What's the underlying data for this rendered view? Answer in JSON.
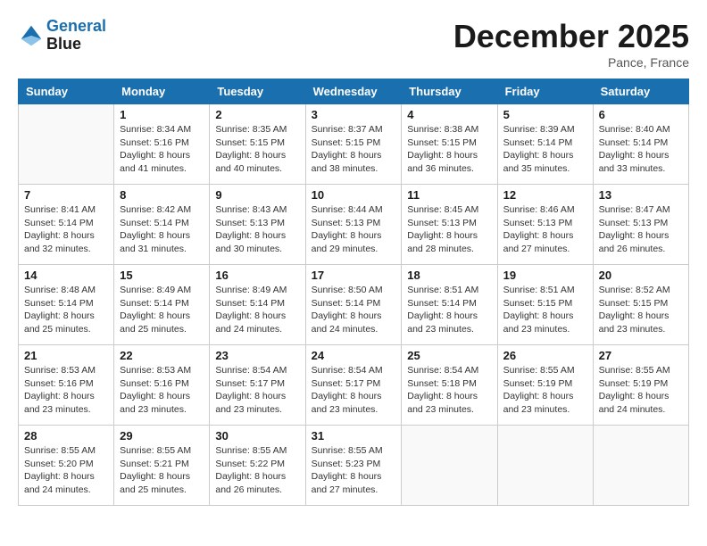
{
  "logo": {
    "text1": "General",
    "text2": "Blue"
  },
  "title": "December 2025",
  "subtitle": "Pance, France",
  "days_header": [
    "Sunday",
    "Monday",
    "Tuesday",
    "Wednesday",
    "Thursday",
    "Friday",
    "Saturday"
  ],
  "weeks": [
    [
      {
        "num": "",
        "info": ""
      },
      {
        "num": "1",
        "info": "Sunrise: 8:34 AM\nSunset: 5:16 PM\nDaylight: 8 hours\nand 41 minutes."
      },
      {
        "num": "2",
        "info": "Sunrise: 8:35 AM\nSunset: 5:15 PM\nDaylight: 8 hours\nand 40 minutes."
      },
      {
        "num": "3",
        "info": "Sunrise: 8:37 AM\nSunset: 5:15 PM\nDaylight: 8 hours\nand 38 minutes."
      },
      {
        "num": "4",
        "info": "Sunrise: 8:38 AM\nSunset: 5:15 PM\nDaylight: 8 hours\nand 36 minutes."
      },
      {
        "num": "5",
        "info": "Sunrise: 8:39 AM\nSunset: 5:14 PM\nDaylight: 8 hours\nand 35 minutes."
      },
      {
        "num": "6",
        "info": "Sunrise: 8:40 AM\nSunset: 5:14 PM\nDaylight: 8 hours\nand 33 minutes."
      }
    ],
    [
      {
        "num": "7",
        "info": "Sunrise: 8:41 AM\nSunset: 5:14 PM\nDaylight: 8 hours\nand 32 minutes."
      },
      {
        "num": "8",
        "info": "Sunrise: 8:42 AM\nSunset: 5:14 PM\nDaylight: 8 hours\nand 31 minutes."
      },
      {
        "num": "9",
        "info": "Sunrise: 8:43 AM\nSunset: 5:13 PM\nDaylight: 8 hours\nand 30 minutes."
      },
      {
        "num": "10",
        "info": "Sunrise: 8:44 AM\nSunset: 5:13 PM\nDaylight: 8 hours\nand 29 minutes."
      },
      {
        "num": "11",
        "info": "Sunrise: 8:45 AM\nSunset: 5:13 PM\nDaylight: 8 hours\nand 28 minutes."
      },
      {
        "num": "12",
        "info": "Sunrise: 8:46 AM\nSunset: 5:13 PM\nDaylight: 8 hours\nand 27 minutes."
      },
      {
        "num": "13",
        "info": "Sunrise: 8:47 AM\nSunset: 5:13 PM\nDaylight: 8 hours\nand 26 minutes."
      }
    ],
    [
      {
        "num": "14",
        "info": "Sunrise: 8:48 AM\nSunset: 5:14 PM\nDaylight: 8 hours\nand 25 minutes."
      },
      {
        "num": "15",
        "info": "Sunrise: 8:49 AM\nSunset: 5:14 PM\nDaylight: 8 hours\nand 25 minutes."
      },
      {
        "num": "16",
        "info": "Sunrise: 8:49 AM\nSunset: 5:14 PM\nDaylight: 8 hours\nand 24 minutes."
      },
      {
        "num": "17",
        "info": "Sunrise: 8:50 AM\nSunset: 5:14 PM\nDaylight: 8 hours\nand 24 minutes."
      },
      {
        "num": "18",
        "info": "Sunrise: 8:51 AM\nSunset: 5:14 PM\nDaylight: 8 hours\nand 23 minutes."
      },
      {
        "num": "19",
        "info": "Sunrise: 8:51 AM\nSunset: 5:15 PM\nDaylight: 8 hours\nand 23 minutes."
      },
      {
        "num": "20",
        "info": "Sunrise: 8:52 AM\nSunset: 5:15 PM\nDaylight: 8 hours\nand 23 minutes."
      }
    ],
    [
      {
        "num": "21",
        "info": "Sunrise: 8:53 AM\nSunset: 5:16 PM\nDaylight: 8 hours\nand 23 minutes."
      },
      {
        "num": "22",
        "info": "Sunrise: 8:53 AM\nSunset: 5:16 PM\nDaylight: 8 hours\nand 23 minutes."
      },
      {
        "num": "23",
        "info": "Sunrise: 8:54 AM\nSunset: 5:17 PM\nDaylight: 8 hours\nand 23 minutes."
      },
      {
        "num": "24",
        "info": "Sunrise: 8:54 AM\nSunset: 5:17 PM\nDaylight: 8 hours\nand 23 minutes."
      },
      {
        "num": "25",
        "info": "Sunrise: 8:54 AM\nSunset: 5:18 PM\nDaylight: 8 hours\nand 23 minutes."
      },
      {
        "num": "26",
        "info": "Sunrise: 8:55 AM\nSunset: 5:19 PM\nDaylight: 8 hours\nand 23 minutes."
      },
      {
        "num": "27",
        "info": "Sunrise: 8:55 AM\nSunset: 5:19 PM\nDaylight: 8 hours\nand 24 minutes."
      }
    ],
    [
      {
        "num": "28",
        "info": "Sunrise: 8:55 AM\nSunset: 5:20 PM\nDaylight: 8 hours\nand 24 minutes."
      },
      {
        "num": "29",
        "info": "Sunrise: 8:55 AM\nSunset: 5:21 PM\nDaylight: 8 hours\nand 25 minutes."
      },
      {
        "num": "30",
        "info": "Sunrise: 8:55 AM\nSunset: 5:22 PM\nDaylight: 8 hours\nand 26 minutes."
      },
      {
        "num": "31",
        "info": "Sunrise: 8:55 AM\nSunset: 5:23 PM\nDaylight: 8 hours\nand 27 minutes."
      },
      {
        "num": "",
        "info": ""
      },
      {
        "num": "",
        "info": ""
      },
      {
        "num": "",
        "info": ""
      }
    ]
  ]
}
